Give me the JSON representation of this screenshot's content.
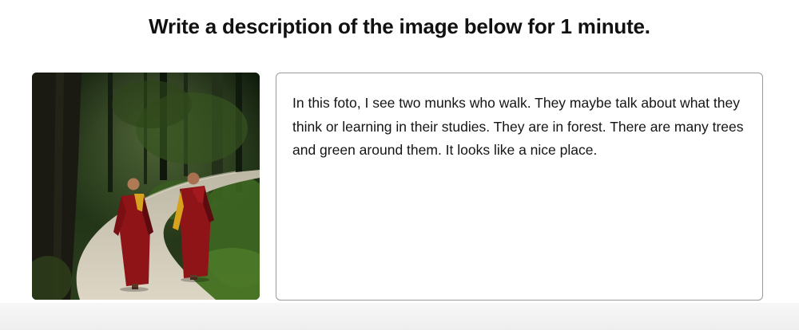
{
  "prompt": {
    "title": "Write a description of the image below for 1 minute."
  },
  "image": {
    "subject": "two-monks-walking-forest-path"
  },
  "answer": {
    "text": "In this foto, I see two munks who walk. They maybe talk about what they think or learning in their studies. They are in forest. There are many trees and green around them. It looks like a nice place."
  },
  "colors": {
    "robe": "#8e1418",
    "robe_shadow": "#5e0b0f",
    "foliage": "#2f4a1e",
    "path": "#cfc8b6",
    "box_border": "#9a9a9a"
  }
}
